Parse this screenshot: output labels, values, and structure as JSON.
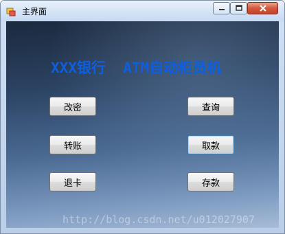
{
  "window": {
    "title": "主界面"
  },
  "main": {
    "heading": "XXX银行  ATM自动柜员机",
    "buttons": {
      "change_password": "改密",
      "query": "查询",
      "transfer": "转账",
      "withdraw": "取款",
      "eject_card": "退卡",
      "deposit": "存款"
    }
  },
  "watermark": "http://blog.csdn.net/u012027907",
  "colors": {
    "heading": "#0d5fe0",
    "close_button": "#c7402a"
  }
}
